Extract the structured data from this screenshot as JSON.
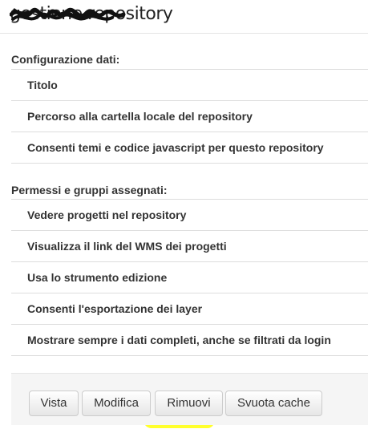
{
  "page": {
    "title": "gestione repository"
  },
  "sections": [
    {
      "heading": "Configurazione dati:",
      "items": [
        "Titolo",
        "Percorso alla cartella locale del repository",
        "Consenti temi e codice javascript per questo repository"
      ]
    },
    {
      "heading": "Permessi e gruppi assegnati:",
      "items": [
        "Vedere progetti nel repository",
        "Visualizza il link del WMS dei progetti",
        "Usa lo strumento edizione",
        "Consenti l'esportazione dei layer",
        "Mostrare sempre i dati completi, anche se filtrati da login"
      ]
    }
  ],
  "actions": {
    "view_label": "Vista",
    "edit_label": "Modifica",
    "remove_label": "Rimuovi",
    "clear_cache_label": "Svuota cache"
  },
  "colors": {
    "highlight": "#ffff1a",
    "border": "#dddddd",
    "footer_bg": "#f5f5f5"
  }
}
